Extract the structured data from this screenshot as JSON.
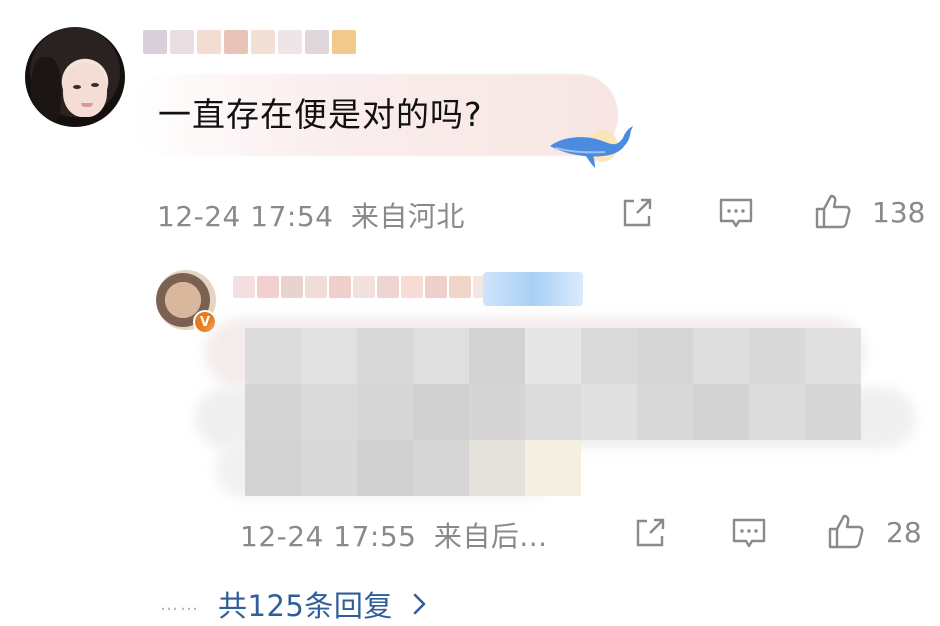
{
  "comment": {
    "text": "一直存在便是对的吗?",
    "date": "12-24 17:54",
    "location": "来自河北",
    "likes": "138",
    "name_blur_colors": [
      "#d9cfd8",
      "#e8dde0",
      "#f3dcd2",
      "#e7c3b8",
      "#f2dfd6",
      "#efe4e6",
      "#e0d7dd",
      "#f2c98c"
    ],
    "bubble_gradient": [
      "#ffffff",
      "#fbeeee",
      "#f7e6e3"
    ]
  },
  "reply": {
    "date": "12-24 17:55",
    "location": "来自后...",
    "likes": "28",
    "verified_badge": "V",
    "name_blur_colors": [
      "#f4dfe0",
      "#f2d0cf",
      "#e9d3d0",
      "#f1ddd8",
      "#f0cfcb",
      "#f3e1de",
      "#eed4d3",
      "#f6dcd3",
      "#eed0cb",
      "#f0d6c9",
      "#f6e6e2"
    ],
    "text_mosaic_colors": [
      [
        "#dcdcdc",
        "#e2e2e2",
        "#d8d8d8",
        "#dfdfdf",
        "#d2d2d2",
        "#e6e6e6",
        "#dadada",
        "#d6d6d6",
        "#dedede",
        "#d9d9d9",
        "#e0e0e0"
      ],
      [
        "#d4d4d4",
        "#dadada",
        "#d6d6d6",
        "#d0d0d0",
        "#d5d5d5",
        "#dbdbdb",
        "#e0e0e0",
        "#d8d8d8",
        "#d2d2d2",
        "#dcdcdc",
        "#d7d7d7"
      ],
      [
        "#d2d2d2",
        "#d9d9d9",
        "#d1d1d1",
        "#d6d6d6",
        "#e3e1da",
        "#f4efe0"
      ]
    ]
  },
  "more_replies": {
    "dots": "……",
    "label": "共125条回复"
  },
  "icons": {
    "share": "share-icon",
    "comment": "comment-icon",
    "like": "thumbs-up-icon",
    "whale": "whale-icon",
    "chevron": "chevron-right-icon"
  },
  "colors": {
    "meta_gray": "#8a8a8a",
    "link_blue": "#2f5f9a",
    "badge_orange": "#e87b1d"
  }
}
